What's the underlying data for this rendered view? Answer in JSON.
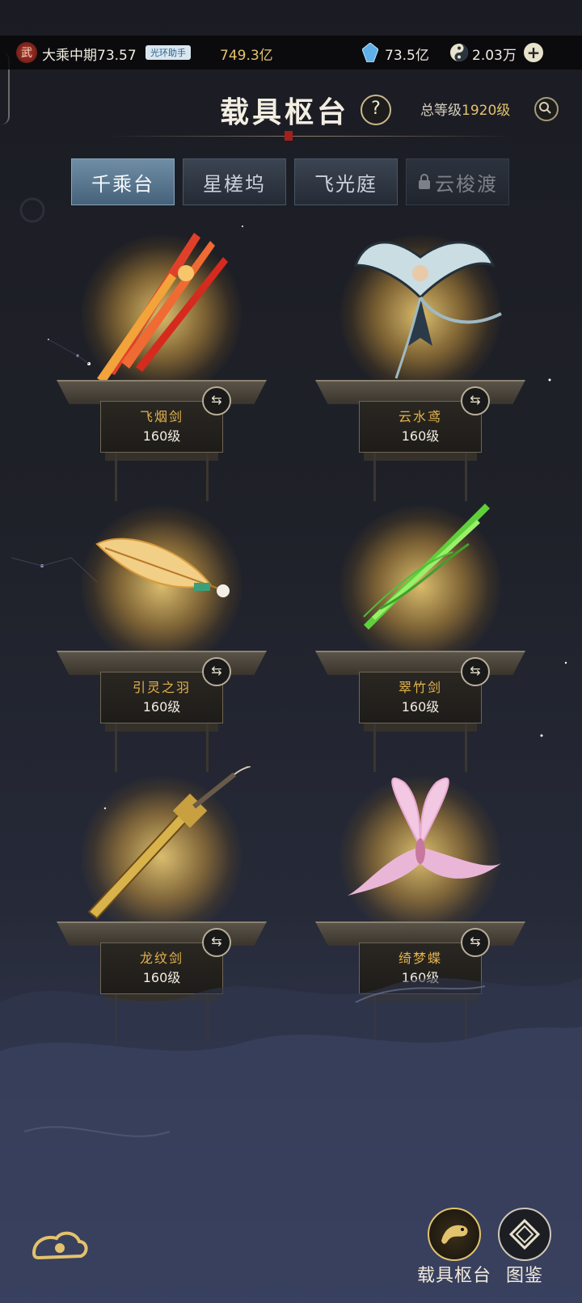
{
  "topbar": {
    "badge": "武",
    "realm": "大乘中期73.57",
    "helper_pill": "光环助手",
    "coins": "749.3亿",
    "gems": "73.5亿",
    "yingbi": "2.03万",
    "plus": "+"
  },
  "header": {
    "title": "载具枢台",
    "help": "?",
    "total_level_prefix": "总等级",
    "total_level_value": "1920级"
  },
  "tabs": [
    {
      "label": "千乘台",
      "active": true,
      "locked": false
    },
    {
      "label": "星槎坞",
      "active": false,
      "locked": false
    },
    {
      "label": "飞光庭",
      "active": false,
      "locked": false
    },
    {
      "label": "云梭渡",
      "active": false,
      "locked": true
    }
  ],
  "items": [
    {
      "name": "飞烟剑",
      "level": "160级",
      "icon": "flame-sword-icon"
    },
    {
      "name": "云水鸢",
      "level": "160级",
      "icon": "swallow-kite-icon"
    },
    {
      "name": "引灵之羽",
      "level": "160级",
      "icon": "feather-icon"
    },
    {
      "name": "翠竹剑",
      "level": "160级",
      "icon": "bamboo-sword-icon"
    },
    {
      "name": "龙纹剑",
      "level": "160级",
      "icon": "dragon-sword-icon"
    },
    {
      "name": "绮梦蝶",
      "level": "160级",
      "icon": "butterfly-icon"
    }
  ],
  "bottom_nav": {
    "vehicle_label": "载具枢台",
    "atlas_label": "图鉴"
  },
  "colors": {
    "gold": "#e3b34d",
    "tab_active": "#5f7f98",
    "background": "#1f2129"
  }
}
